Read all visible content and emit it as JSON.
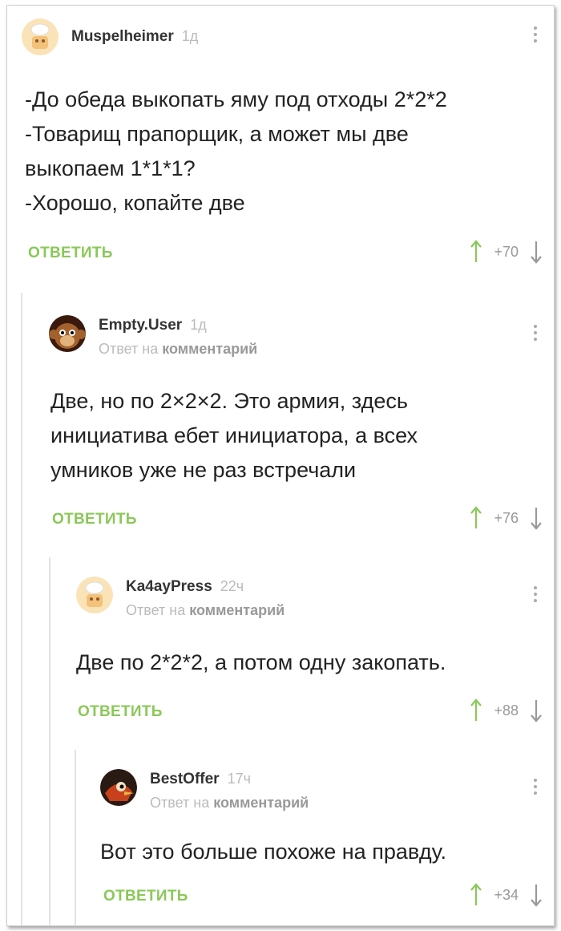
{
  "comments": [
    {
      "author": "Muspelheimer",
      "time": "1д",
      "reply_to": "",
      "text": [
        "-До обеда выкопать яму под отходы 2*2*2",
        "-Товарищ прапорщик, а может мы две",
        "выкопаем 1*1*1?",
        "-Хорошо, копайте две"
      ],
      "reply_label": "ОТВЕТИТЬ",
      "score": "+70"
    },
    {
      "author": "Empty.User",
      "time": "1д",
      "reply_to_prefix": "Ответ на",
      "reply_to": "комментарий",
      "text": [
        "Две, но по 2×2×2. Это армия, здесь",
        "инициатива ебет инициатора, а всех",
        "умников уже не раз встречали"
      ],
      "reply_label": "ОТВЕТИТЬ",
      "score": "+76"
    },
    {
      "author": "Ka4ayPress",
      "time": "22ч",
      "reply_to_prefix": "Ответ на",
      "reply_to": "комментарий",
      "text": [
        "Две по 2*2*2, а потом одну закопать."
      ],
      "reply_label": "ОТВЕТИТЬ",
      "score": "+88"
    },
    {
      "author": "BestOffer",
      "time": "17ч",
      "reply_to_prefix": "Ответ на",
      "reply_to": "комментарий",
      "text": [
        "Вот это больше похоже на правду."
      ],
      "reply_label": "ОТВЕТИТЬ",
      "score": "+34"
    }
  ],
  "colors": {
    "accent_green": "#8ac858",
    "muted": "#bbbbbb"
  },
  "icons": [
    "avatar",
    "more-vertical-icon",
    "upvote-arrow-icon",
    "downvote-arrow-icon"
  ]
}
